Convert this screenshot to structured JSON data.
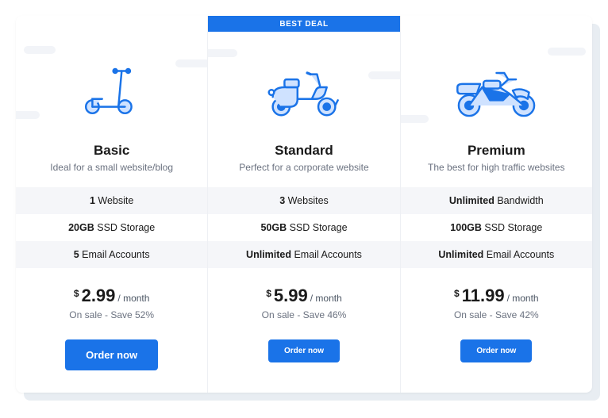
{
  "plans": [
    {
      "badge": "",
      "name": "Basic",
      "tagline": "Ideal for a small website/blog",
      "features": [
        {
          "bold": "1",
          "rest": " Website"
        },
        {
          "bold": "20GB",
          "rest": " SSD Storage"
        },
        {
          "bold": "5",
          "rest": " Email Accounts"
        }
      ],
      "currency": "$",
      "price": "2.99",
      "period": "/ month",
      "sale": "On sale - Save 52%",
      "cta": "Order now",
      "cta_size": "large",
      "icon": "scooter"
    },
    {
      "badge": "BEST DEAL",
      "name": "Standard",
      "tagline": "Perfect for a corporate website",
      "features": [
        {
          "bold": "3",
          "rest": " Websites"
        },
        {
          "bold": "50GB",
          "rest": " SSD Storage"
        },
        {
          "bold": "Unlimited",
          "rest": " Email Accounts"
        }
      ],
      "currency": "$",
      "price": "5.99",
      "period": "/ month",
      "sale": "On sale - Save 46%",
      "cta": "Order now",
      "cta_size": "small",
      "icon": "moped"
    },
    {
      "badge": "",
      "name": "Premium",
      "tagline": "The best for high traffic websites",
      "features": [
        {
          "bold": "Unlimited",
          "rest": " Bandwidth"
        },
        {
          "bold": "100GB",
          "rest": " SSD Storage"
        },
        {
          "bold": "Unlimited",
          "rest": " Email Accounts"
        }
      ],
      "currency": "$",
      "price": "11.99",
      "period": "/ month",
      "sale": "On sale - Save 42%",
      "cta": "Order now",
      "cta_size": "small",
      "icon": "motorcycle"
    }
  ]
}
